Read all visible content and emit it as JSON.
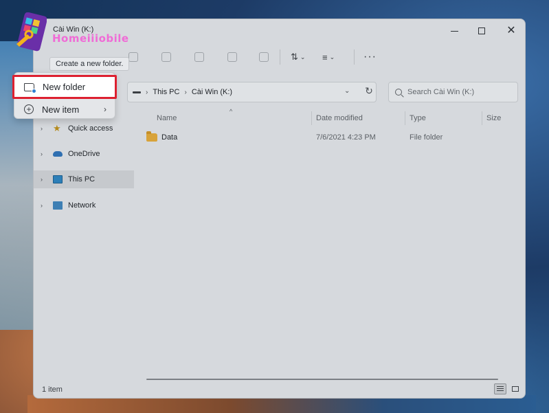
{
  "window": {
    "title": "Cài Win (K:)"
  },
  "toolbar": {
    "more_label": "···"
  },
  "tooltip": {
    "text": "Create a new folder."
  },
  "new_menu": {
    "items": [
      {
        "label": "New folder",
        "icon": "new-folder-icon",
        "highlighted": true
      },
      {
        "label": "New item",
        "icon": "plus-circle-icon",
        "has_submenu": true
      }
    ]
  },
  "address": {
    "crumbs": [
      "This PC",
      "Cài Win (K:)"
    ]
  },
  "search": {
    "placeholder": "Search Cài Win (K:)"
  },
  "nav": {
    "items": [
      {
        "label": "Quick access",
        "icon": "star-icon"
      },
      {
        "label": "OneDrive",
        "icon": "cloud-icon"
      },
      {
        "label": "This PC",
        "icon": "computer-icon",
        "selected": true
      },
      {
        "label": "Network",
        "icon": "network-icon"
      }
    ]
  },
  "columns": {
    "name": "Name",
    "date": "Date modified",
    "type": "Type",
    "size": "Size"
  },
  "files": [
    {
      "name": "Data",
      "date": "7/6/2021 4:23 PM",
      "type": "File folder",
      "size": ""
    }
  ],
  "status": {
    "count": "1 item"
  },
  "logo": {
    "text": "Homeiiiobile"
  },
  "colors": {
    "highlight_border": "#dd2030",
    "accent": "#2d7fd2",
    "logo_pink": "#f06bd6"
  }
}
